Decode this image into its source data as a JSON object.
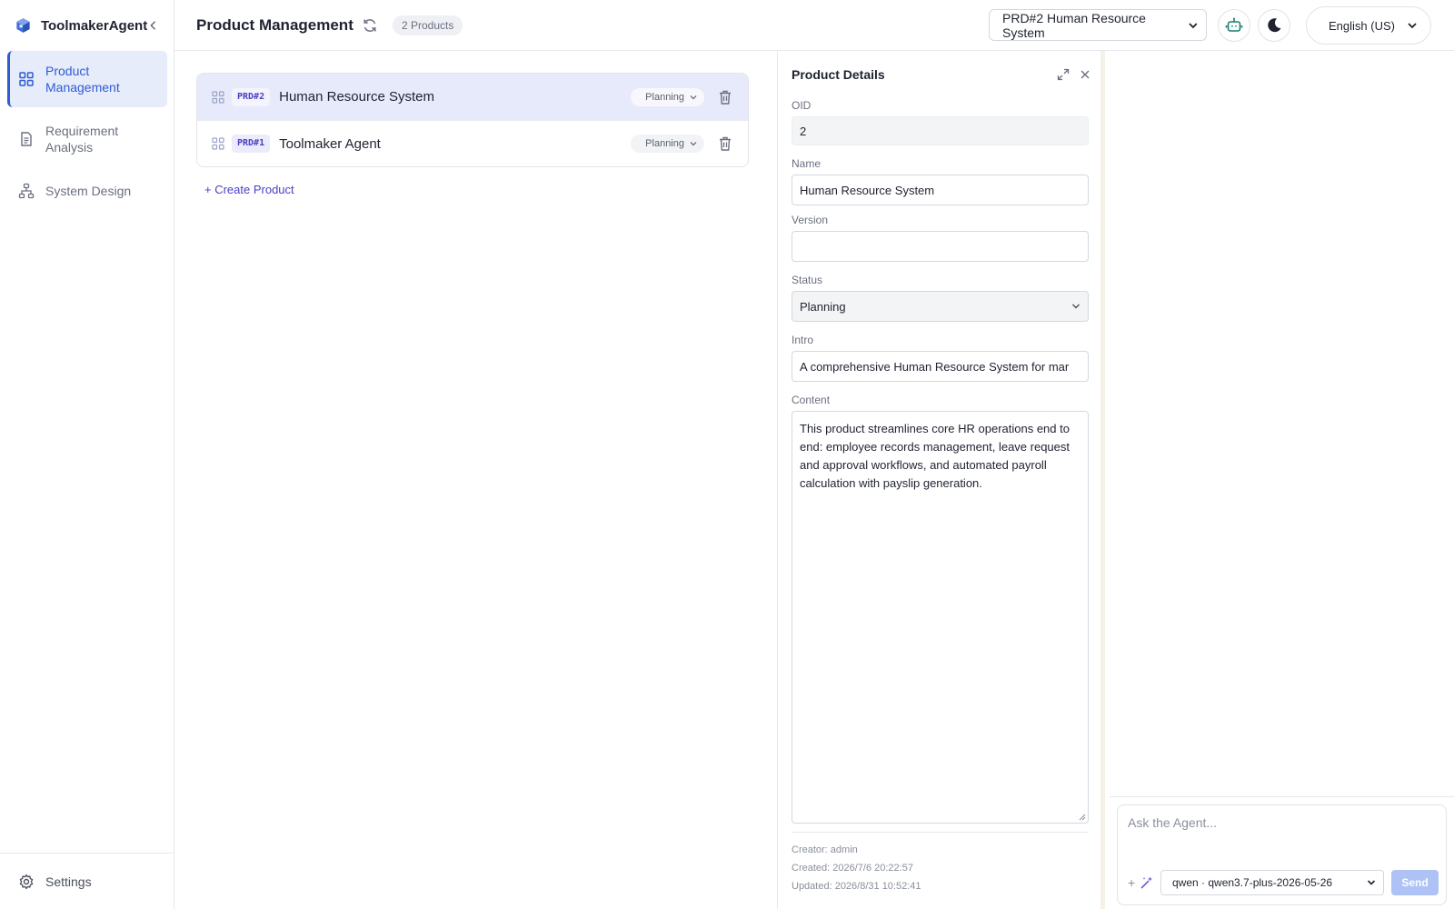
{
  "app": {
    "name": "ToolmakerAgent"
  },
  "sidebar": {
    "items": [
      {
        "label": "Product Management",
        "icon": "grid-icon",
        "active": true
      },
      {
        "label": "Requirement Analysis",
        "icon": "document-icon",
        "active": false
      },
      {
        "label": "System Design",
        "icon": "hierarchy-icon",
        "active": false
      }
    ],
    "settings_label": "Settings"
  },
  "header": {
    "title": "Product Management",
    "count_badge": "2 Products",
    "current_product": "PRD#2 Human Resource System",
    "language": "English (US)"
  },
  "products": [
    {
      "code": "PRD#2",
      "name": "Human Resource System",
      "status": "Planning",
      "selected": true
    },
    {
      "code": "PRD#1",
      "name": "Toolmaker Agent",
      "status": "Planning",
      "selected": false
    }
  ],
  "create_product_label": "+ Create Product",
  "details": {
    "title": "Product Details",
    "oid_label": "OID",
    "oid": "2",
    "name_label": "Name",
    "name": "Human Resource System",
    "version_label": "Version",
    "version": "",
    "status_label": "Status",
    "status": "Planning",
    "intro_label": "Intro",
    "intro": "A comprehensive Human Resource System for mar",
    "content_label": "Content",
    "content": "This product streamlines core HR operations end to end: employee records management, leave request and approval workflows, and automated payroll calculation with payslip generation.",
    "creator": "Creator: admin",
    "created": "Created: 2026/7/6 20:22:57",
    "updated": "Updated: 2026/8/31 10:52:41"
  },
  "chat": {
    "placeholder": "Ask the Agent...",
    "plus": "+",
    "model": "qwen · qwen3.7-plus-2026-05-26",
    "send_label": "Send"
  },
  "colors": {
    "accent": "#2f5bd3",
    "active_bg": "#e7ecfb",
    "selected_row_bg": "#e7eafb",
    "link": "#4b3fc5",
    "send_disabled": "#aec2f5"
  }
}
